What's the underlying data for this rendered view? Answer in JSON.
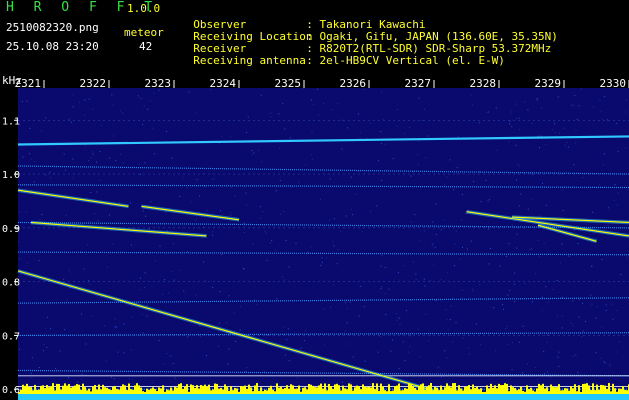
{
  "header": {
    "app_title": "H R O F F T",
    "version": "1.0.0",
    "filename": "2510082320.png",
    "datetime": "25.10.08 23:20",
    "meteor_label": "meteor",
    "meteor_count": "42"
  },
  "info": [
    {
      "label": "Observer",
      "value": "Takanori Kawachi"
    },
    {
      "label": "Receiving Location",
      "value": "Ogaki, Gifu, JAPAN (136.60E, 35.35N)"
    },
    {
      "label": "Receiver",
      "value": "R820T2(RTL-SDR) SDR-Sharp 53.372MHz"
    },
    {
      "label": "Receiving antenna",
      "value": "2el-HB9CV Vertical (el. E-W)"
    }
  ],
  "colors": {
    "background": "#000000",
    "plot_background": "#0a0a6e",
    "header_yellow": "#ffff30",
    "title_green": "#38e048",
    "trace_cyan": "#30c8ff",
    "signal_yellow": "#ffff00"
  },
  "chart_data": {
    "type": "heatmap",
    "xlabel": "",
    "ylabel": "kHz",
    "x_ticks": [
      "2321",
      "2322",
      "2323",
      "2324",
      "2325",
      "2326",
      "2327",
      "2328",
      "2329",
      "2330"
    ],
    "y_ticks": [
      "1.1",
      "1.0",
      "0.9",
      "0.8",
      "0.7",
      "0.6"
    ],
    "ylim": [
      0.58,
      1.16
    ],
    "xlim": [
      2320.6,
      2330.0
    ],
    "grid": "horizontal lines at ticks",
    "traces": [
      {
        "name": "carrier",
        "x": [
          2320.6,
          2330.0
        ],
        "y": [
          1.055,
          1.07
        ]
      },
      {
        "name": "",
        "x": [
          2320.6,
          2330.0
        ],
        "y": [
          0.91,
          0.9
        ]
      },
      {
        "name": "",
        "x": [
          2320.6,
          2330.0
        ],
        "y": [
          1.015,
          1.0
        ]
      },
      {
        "name": "",
        "x": [
          2320.6,
          2330.0
        ],
        "y": [
          0.855,
          0.85
        ]
      },
      {
        "name": "",
        "x": [
          2320.6,
          2330.0
        ],
        "y": [
          0.76,
          0.77
        ]
      },
      {
        "name": "",
        "x": [
          2320.6,
          2330.0
        ],
        "y": [
          0.7,
          0.705
        ]
      },
      {
        "name": "",
        "x": [
          2320.6,
          2330.0
        ],
        "y": [
          0.98,
          0.975
        ]
      },
      {
        "name": "",
        "x": [
          2320.6,
          2330.0
        ],
        "y": [
          0.635,
          0.625
        ]
      },
      {
        "name": "",
        "x": [
          2320.6,
          2330.0
        ],
        "y": [
          0.6,
          0.6
        ]
      }
    ],
    "doppler_streaks": [
      {
        "x": [
          2320.6,
          2327.5
        ],
        "y": [
          0.82,
          0.58
        ]
      },
      {
        "x": [
          2320.6,
          2322.3
        ],
        "y": [
          0.97,
          0.94
        ]
      },
      {
        "x": [
          2322.5,
          2324.0
        ],
        "y": [
          0.94,
          0.915
        ]
      },
      {
        "x": [
          2320.8,
          2323.5
        ],
        "y": [
          0.91,
          0.885
        ]
      },
      {
        "x": [
          2327.5,
          2330.0
        ],
        "y": [
          0.93,
          0.885
        ]
      },
      {
        "x": [
          2328.2,
          2330.0
        ],
        "y": [
          0.92,
          0.91
        ]
      },
      {
        "x": [
          2328.6,
          2329.5
        ],
        "y": [
          0.905,
          0.875
        ]
      }
    ]
  }
}
